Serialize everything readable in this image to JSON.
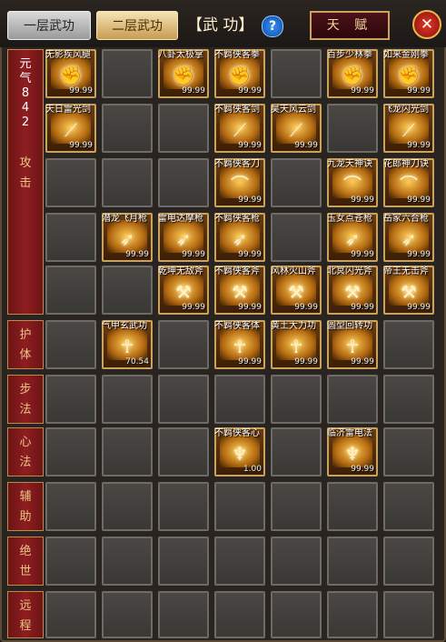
{
  "tabs": {
    "tab1": "一层武功",
    "tab2": "二层武功"
  },
  "title": "【武 功】",
  "help_label": "?",
  "talent_label": "天 赋",
  "close_label": "✕",
  "categories": [
    {
      "label": "元气842攻击"
    },
    {
      "label": "护体"
    },
    {
      "label": "步法"
    },
    {
      "label": "心法"
    },
    {
      "label": "辅助"
    },
    {
      "label": "绝世"
    },
    {
      "label": "远程"
    }
  ],
  "sidebar_top": {
    "line1": "元",
    "line2": "气",
    "line3": "8",
    "line4": "4",
    "line5": "2",
    "attack1": "攻",
    "attack2": "击"
  },
  "skills": [
    {
      "row": 0,
      "col": 0,
      "name": "无影疾风腿",
      "value": "99.99",
      "icon": "fist-icon"
    },
    {
      "row": 0,
      "col": 2,
      "name": "八卦太极掌",
      "value": "99.99",
      "icon": "fist-icon"
    },
    {
      "row": 0,
      "col": 3,
      "name": "不羁侠客拳",
      "value": "99.99",
      "icon": "fist-icon"
    },
    {
      "row": 0,
      "col": 5,
      "name": "百步少林拳",
      "value": "99.99",
      "icon": "fist-icon"
    },
    {
      "row": 0,
      "col": 6,
      "name": "如来金刚拳",
      "value": "99.99",
      "icon": "fist-icon"
    },
    {
      "row": 1,
      "col": 0,
      "name": "天日雷光剑",
      "value": "99.99",
      "icon": "sword-icon"
    },
    {
      "row": 1,
      "col": 3,
      "name": "不羁侠客剑",
      "value": "99.99",
      "icon": "sword-icon"
    },
    {
      "row": 1,
      "col": 4,
      "name": "昊天风云剑",
      "value": "99.99",
      "icon": "sword-icon"
    },
    {
      "row": 1,
      "col": 6,
      "name": "飞龙闪光剑",
      "value": "99.99",
      "icon": "sword-icon"
    },
    {
      "row": 2,
      "col": 3,
      "name": "不羁侠客刀",
      "value": "99.99",
      "icon": "blade-icon"
    },
    {
      "row": 2,
      "col": 5,
      "name": "九龙天神诀",
      "value": "99.99",
      "icon": "blade-icon"
    },
    {
      "row": 2,
      "col": 6,
      "name": "花郎神刀诀",
      "value": "99.99",
      "icon": "blade-icon"
    },
    {
      "row": 3,
      "col": 1,
      "name": "潜龙飞月枪",
      "value": "99.99",
      "icon": "spear-icon"
    },
    {
      "row": 3,
      "col": 2,
      "name": "雷电达摩枪",
      "value": "99.99",
      "icon": "spear-icon"
    },
    {
      "row": 3,
      "col": 3,
      "name": "不羁侠客枪",
      "value": "99.99",
      "icon": "spear-icon"
    },
    {
      "row": 3,
      "col": 5,
      "name": "玉女点苍枪",
      "value": "99.99",
      "icon": "spear-icon"
    },
    {
      "row": 3,
      "col": 6,
      "name": "岳家六合枪",
      "value": "99.99",
      "icon": "spear-icon"
    },
    {
      "row": 4,
      "col": 2,
      "name": "乾坤无敌斧",
      "value": "99.99",
      "icon": "axe-icon"
    },
    {
      "row": 4,
      "col": 3,
      "name": "不羁侠客斧",
      "value": "99.99",
      "icon": "axe-icon"
    },
    {
      "row": 4,
      "col": 4,
      "name": "风林火山斧",
      "value": "99.99",
      "icon": "axe-icon"
    },
    {
      "row": 4,
      "col": 5,
      "name": "北冥闪光斧",
      "value": "99.99",
      "icon": "axe-icon"
    },
    {
      "row": 4,
      "col": 6,
      "name": "帝王无击斧",
      "value": "99.99",
      "icon": "axe-icon"
    },
    {
      "row": 5,
      "col": 1,
      "name": "气甲玄武功",
      "value": "70.54",
      "icon": "body-icon"
    },
    {
      "row": 5,
      "col": 3,
      "name": "不羁侠客体",
      "value": "99.99",
      "icon": "body-icon"
    },
    {
      "row": 5,
      "col": 4,
      "name": "黄土大力功",
      "value": "99.99",
      "icon": "body-icon"
    },
    {
      "row": 5,
      "col": 5,
      "name": "圆型回转功",
      "value": "99.99",
      "icon": "body-icon"
    },
    {
      "row": 7,
      "col": 3,
      "name": "不羁侠客心",
      "value": "1.00",
      "icon": "meditate-icon"
    },
    {
      "row": 7,
      "col": 5,
      "name": "临济雷电法",
      "value": "99.99",
      "icon": "meditate-icon"
    }
  ]
}
